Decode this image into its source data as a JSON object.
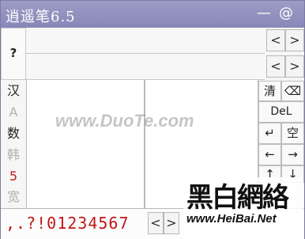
{
  "window": {
    "title": "逍遥笔6.5",
    "minimize_label": "—",
    "at_label": "@"
  },
  "top_left": {
    "help_label": "?"
  },
  "nav": {
    "prev": "<",
    "next": ">"
  },
  "left_column": [
    {
      "label": "汉",
      "color": "#222222"
    },
    {
      "label": "A",
      "color": "#b0b0b0"
    },
    {
      "label": "数",
      "color": "#222222"
    },
    {
      "label": "韩",
      "color": "#b0b0b0"
    },
    {
      "label": "5",
      "color": "#c01818"
    },
    {
      "label": "宽",
      "color": "#b0b0b0"
    }
  ],
  "right_buttons": {
    "clear": "清",
    "backspace": "⌫",
    "del": "DeL",
    "enter": "↵",
    "space": "空",
    "left": "←",
    "right": "→",
    "up": "↑",
    "down": "↓"
  },
  "bottom": {
    "punctuation": ",.?!01234567",
    "prev": "<",
    "next": ">"
  },
  "watermarks": {
    "duote": "www.DuoTe.com",
    "heibai_logo": "黑白網絡",
    "heibai_url": "www.HeiBai.Net"
  }
}
